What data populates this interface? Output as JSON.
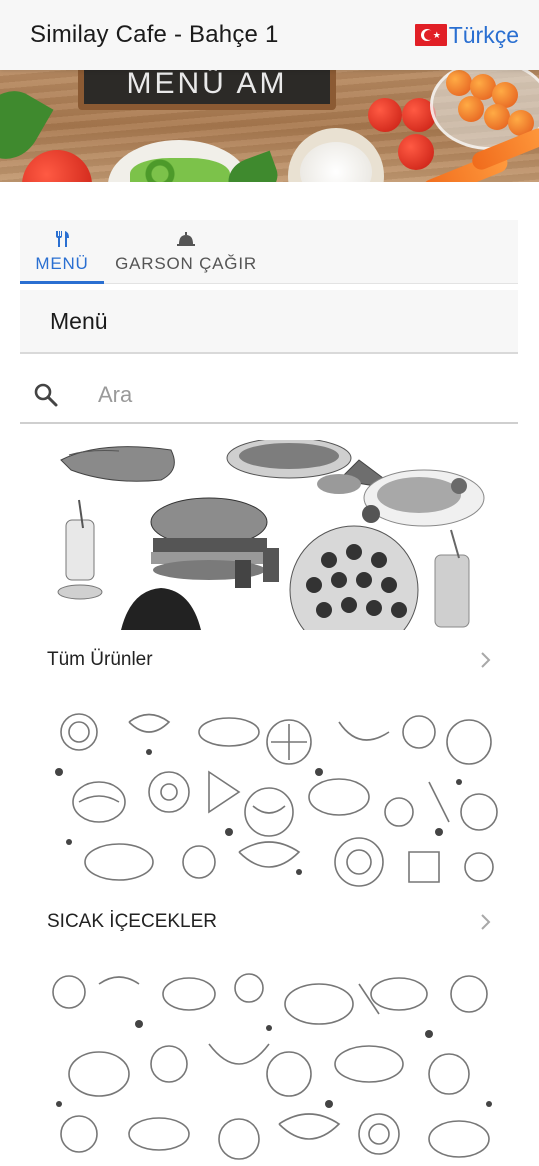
{
  "header": {
    "title": "Similay Cafe - Bahçe 1",
    "language_label": "Türkçe",
    "flag_icon": "turkey-flag-icon"
  },
  "banner": {
    "board_text": "MENÜ AM"
  },
  "tabs": [
    {
      "label": "MENÜ",
      "icon": "cutlery-icon",
      "active": true
    },
    {
      "label": "GARSON ÇAĞIR",
      "icon": "service-bell-icon",
      "active": false
    }
  ],
  "section": {
    "title": "Menü"
  },
  "search": {
    "placeholder": "Ara",
    "value": ""
  },
  "categories": [
    {
      "name": "Tüm Ürünler",
      "image": "food-collage-illustration"
    },
    {
      "name": "SICAK İÇECEKLER",
      "image": "food-doodle-pattern"
    },
    {
      "name": "",
      "image": "food-doodle-pattern"
    }
  ],
  "colors": {
    "accent": "#2a6fd1",
    "header_bg": "#f7f7f7",
    "flag_red": "#e11f26"
  }
}
